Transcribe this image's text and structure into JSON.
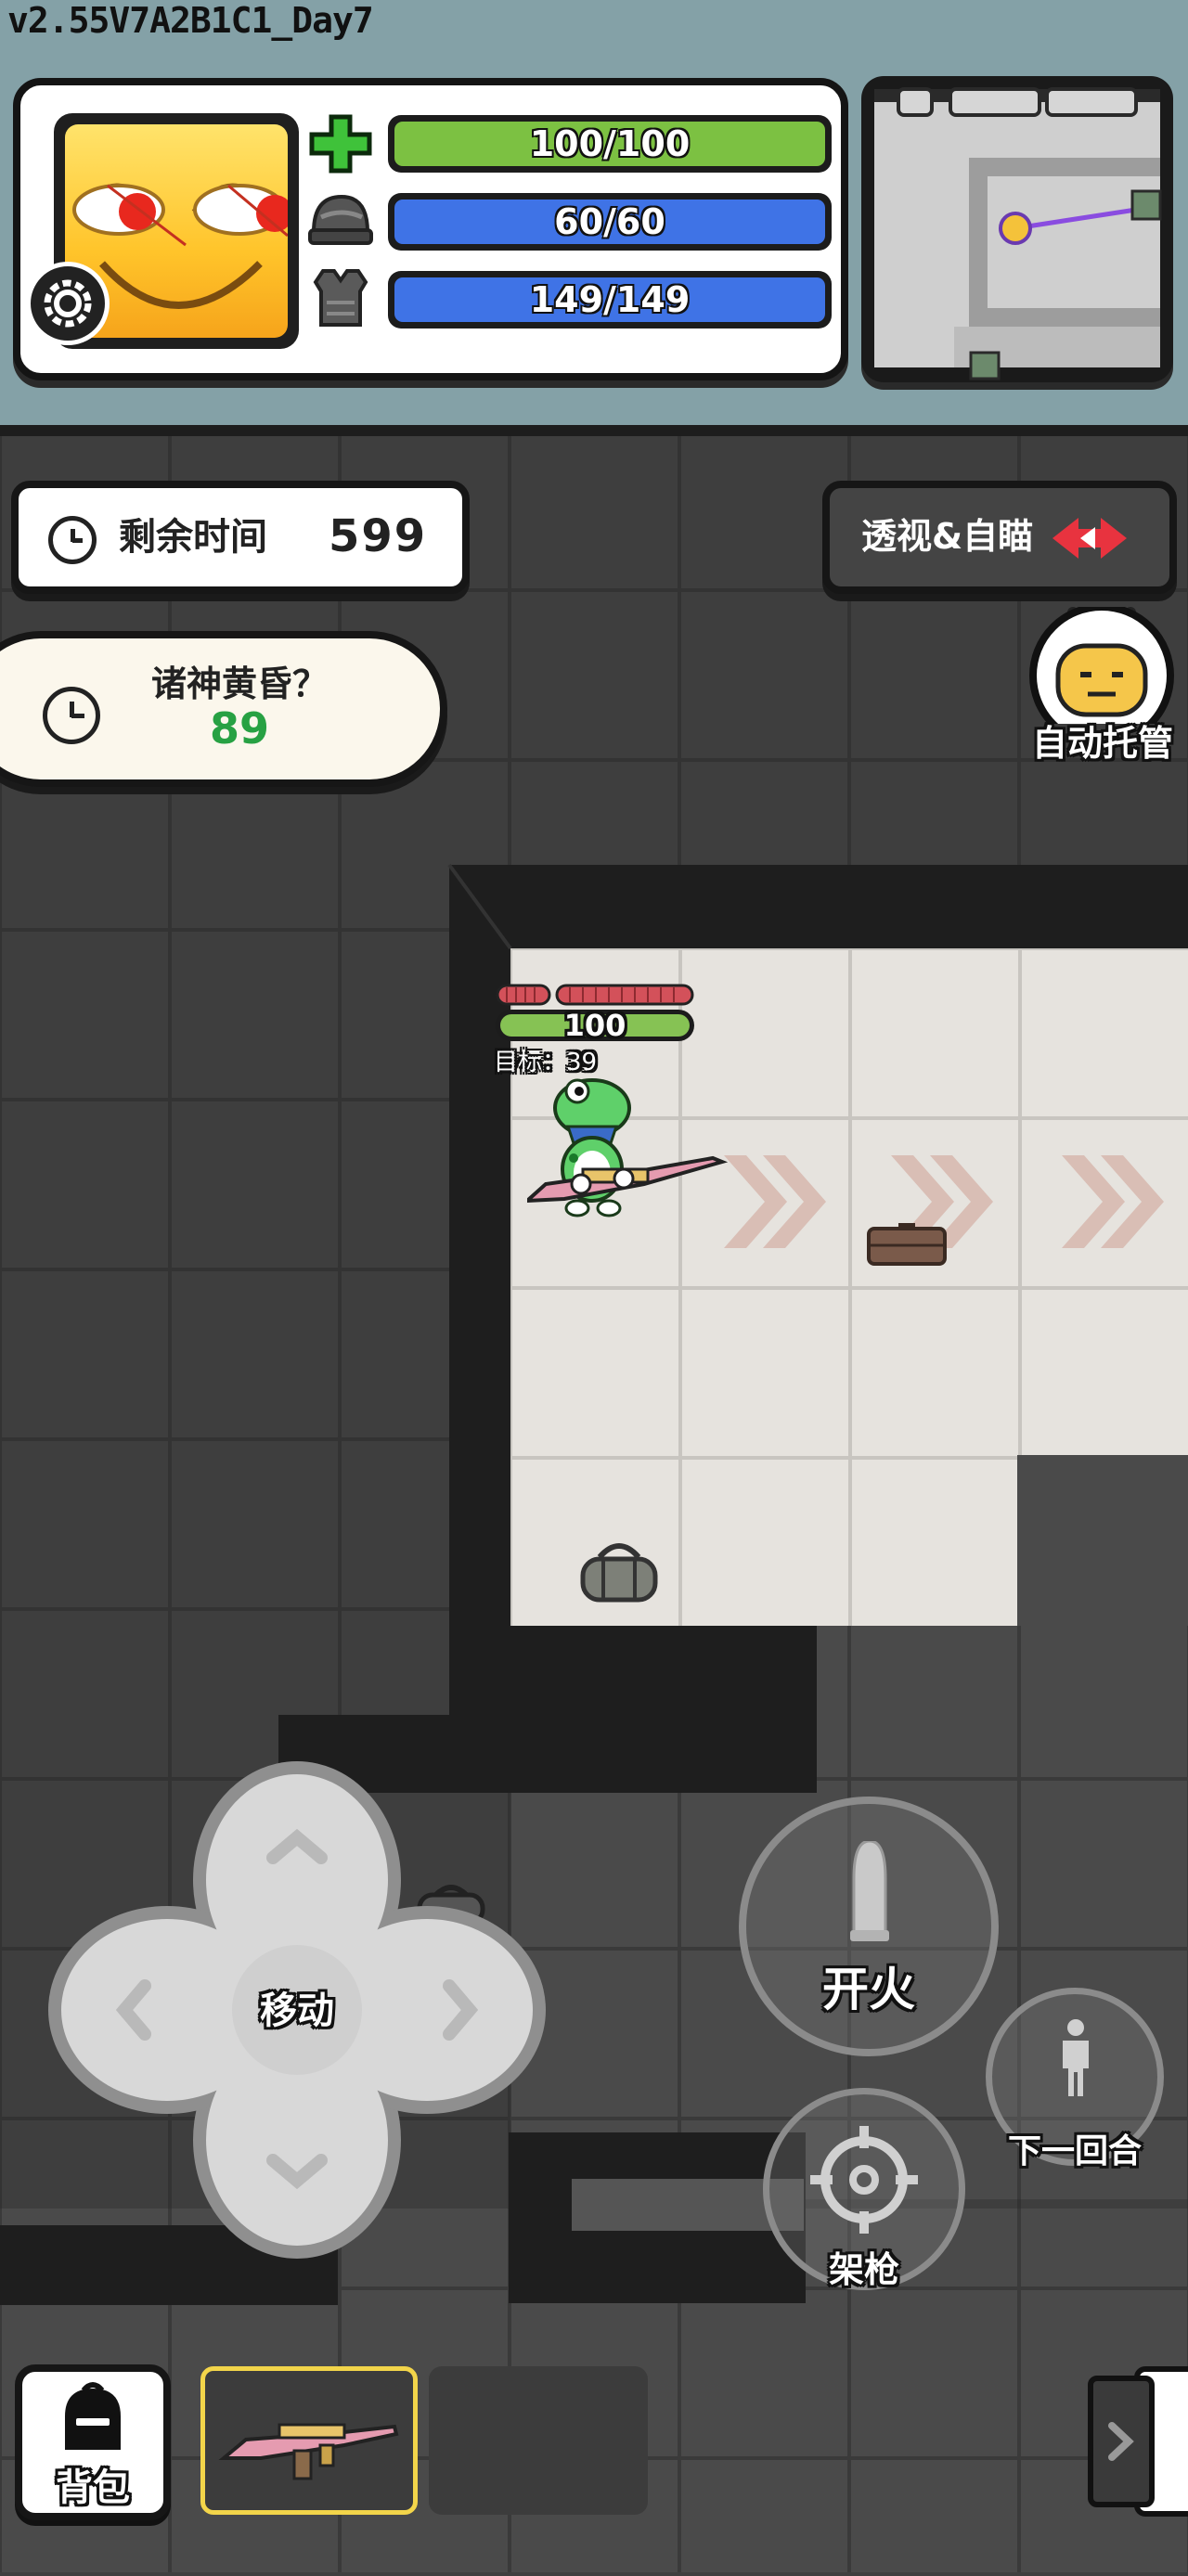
{
  "version": "v2.55V7A2B1C1_Day7",
  "status": {
    "health": {
      "text": "100/100",
      "fraction": 1.0,
      "color": "#7cc142",
      "icon": "plus-icon"
    },
    "helmet": {
      "text": "60/60",
      "fraction": 1.0,
      "color": "#3f73e6",
      "icon": "helmet-icon"
    },
    "armor": {
      "text": "149/149",
      "fraction": 1.0,
      "color": "#3f73e6",
      "icon": "armor-vest-icon"
    }
  },
  "timer": {
    "label": "剩余时间",
    "value": "599"
  },
  "event": {
    "title": "诸神黄昏？",
    "value": "89",
    "value_color": "#27a143"
  },
  "xray_button": {
    "label": "透视&自瞄"
  },
  "auto_button": {
    "label": "自动托管"
  },
  "player": {
    "health": "100",
    "target_label": "目标：39"
  },
  "dpad": {
    "label": "移动"
  },
  "fire_button": {
    "label": "开火"
  },
  "next_turn_button": {
    "label": "下一回合"
  },
  "aim_button": {
    "label": "架枪"
  },
  "bag_button": {
    "label": "背包"
  },
  "colors": {
    "accent_red": "#e8333f",
    "slot_highlight": "#f3d54a"
  }
}
